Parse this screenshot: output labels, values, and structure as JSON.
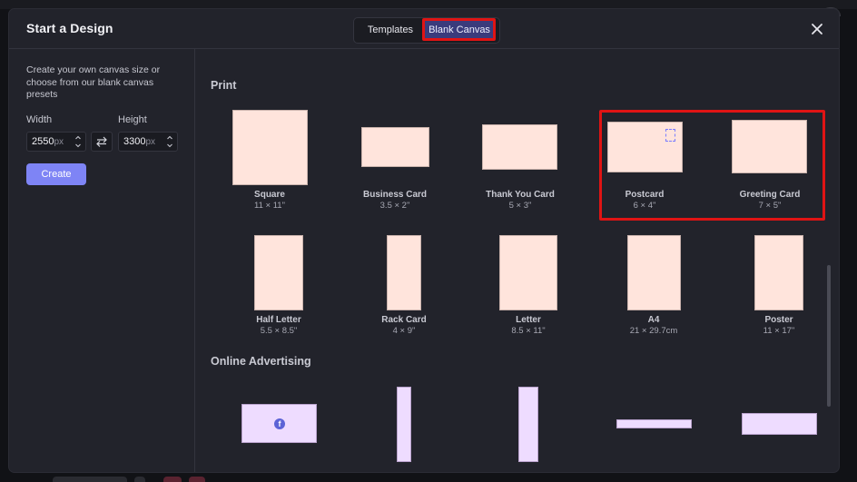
{
  "modal": {
    "title": "Start a Design",
    "tabs": [
      {
        "label": "Templates",
        "active": false
      },
      {
        "label": "Blank Canvas",
        "active": true
      }
    ]
  },
  "sidebar": {
    "intro": "Create your own canvas size or choose from our blank canvas presets",
    "width_label": "Width",
    "height_label": "Height",
    "width_value": "2550",
    "height_value": "3300",
    "unit": "px",
    "create_label": "Create"
  },
  "sections": {
    "print_title": "Print",
    "online_title": "Online Advertising"
  },
  "print_presets": [
    {
      "name": "Square",
      "size": "11 × 11\""
    },
    {
      "name": "Business Card",
      "size": "3.5 × 2\""
    },
    {
      "name": "Thank You Card",
      "size": "5 × 3\""
    },
    {
      "name": "Postcard",
      "size": "6 × 4\""
    },
    {
      "name": "Greeting Card",
      "size": "7 × 5\""
    },
    {
      "name": "Half Letter",
      "size": "5.5 × 8.5\""
    },
    {
      "name": "Rack Card",
      "size": "4 × 9\""
    },
    {
      "name": "Letter",
      "size": "8.5 × 11\""
    },
    {
      "name": "A4",
      "size": "21 × 29.7cm"
    },
    {
      "name": "Poster",
      "size": "11 × 17\""
    }
  ],
  "online_presets": [
    {
      "icon": "facebook-icon"
    },
    {},
    {},
    {},
    {}
  ],
  "colors": {
    "accent": "#7e84f5",
    "print_thumb": "#ffe4dc",
    "online_thumb": "#eedcff",
    "annotation_red": "#e01414"
  }
}
